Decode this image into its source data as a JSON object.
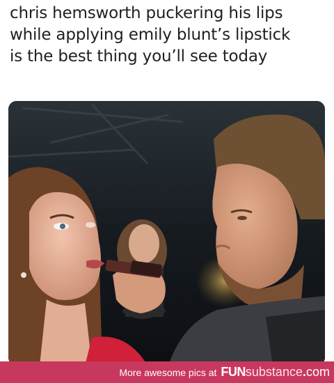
{
  "caption": {
    "line1": "chris hemsworth puckering his lips",
    "line2": "while applying emily blunt’s lipstick",
    "line3": "is the best thing you’ll see today"
  },
  "footer": {
    "promo_text": "More awesome pics at",
    "brand_fun": "FUN",
    "brand_sub": "substance",
    "brand_dot": ".",
    "brand_com": "com",
    "bar_color": "#c8385e"
  }
}
